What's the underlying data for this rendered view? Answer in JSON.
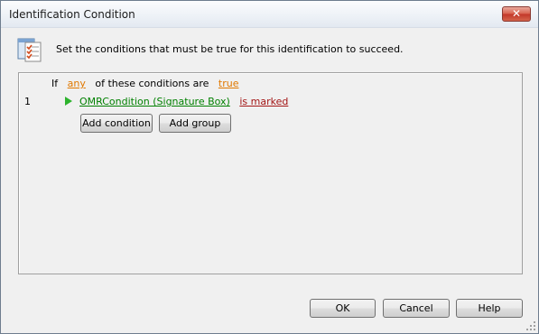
{
  "window": {
    "title": "Identification Condition",
    "close_label": "✕"
  },
  "info": {
    "icon": "checklist-icon",
    "text": "Set the conditions that must be true for this identification to succeed."
  },
  "rule": {
    "if_label": "If",
    "any_label": "any",
    "middle_label": "of these conditions are",
    "true_label": "true",
    "row_number": "1",
    "condition_label": "OMRCondition (Signature Box)",
    "state_label": "is marked",
    "add_condition_label": "Add condition",
    "add_group_label": "Add group"
  },
  "footer": {
    "ok_label": "OK",
    "cancel_label": "Cancel",
    "help_label": "Help"
  },
  "colors": {
    "keyword": "#e07800",
    "condition": "#008000",
    "state": "#a31515",
    "play": "#2db32d"
  }
}
